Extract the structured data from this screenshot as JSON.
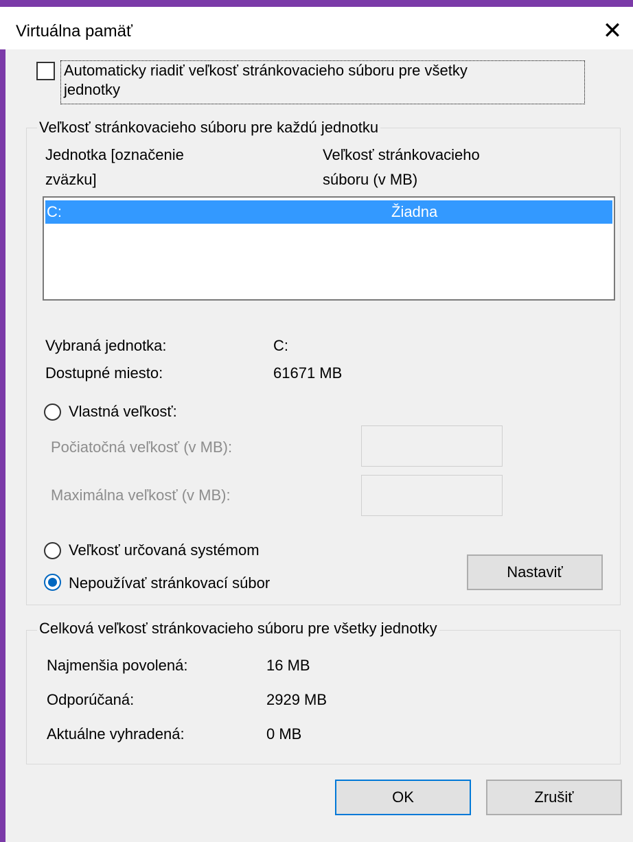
{
  "window": {
    "title": "Virtuálna pamäť",
    "close_symbol": "✕"
  },
  "auto_manage": {
    "label_line1": "Automaticky riadiť veľkosť stránkovacieho súboru pre všetky",
    "label_line2": "jednotky",
    "checked": false
  },
  "per_drive": {
    "legend": "Veľkosť stránkovacieho súboru pre každú jednotku",
    "col_drive_line1": "Jednotka [označenie",
    "col_drive_line2": "zväzku]",
    "col_size_line1": "Veľkosť stránkovacieho",
    "col_size_line2": "súboru (v MB)",
    "rows": [
      {
        "drive": "C:",
        "size": "Žiadna",
        "selected": true
      }
    ],
    "selected_drive_label": "Vybraná jednotka:",
    "selected_drive_value": "C:",
    "free_space_label": "Dostupné miesto:",
    "free_space_value": "61671 MB",
    "custom_size_label": "Vlastná veľkosť:",
    "initial_size_label": "Počiatočná veľkosť (v MB):",
    "initial_size_value": "",
    "max_size_label": "Maximálna veľkosť (v MB):",
    "max_size_value": "",
    "system_managed_label": "Veľkosť určovaná systémom",
    "no_paging_label": "Nepoužívať stránkovací súbor",
    "selected_option": "no_paging",
    "set_button": "Nastaviť"
  },
  "totals": {
    "legend": "Celková veľkosť stránkovacieho súboru pre všetky jednotky",
    "min_label": "Najmenšia povolená:",
    "min_value": "16 MB",
    "recommended_label": "Odporúčaná:",
    "recommended_value": "2929 MB",
    "current_label": "Aktuálne vyhradená:",
    "current_value": "0 MB"
  },
  "buttons": {
    "ok": "OK",
    "cancel": "Zrušiť"
  },
  "colors": {
    "border_accent": "#7b3aa8",
    "selection": "#3399ff",
    "radio_accent": "#0067c0",
    "default_button_border": "#0078d7"
  }
}
